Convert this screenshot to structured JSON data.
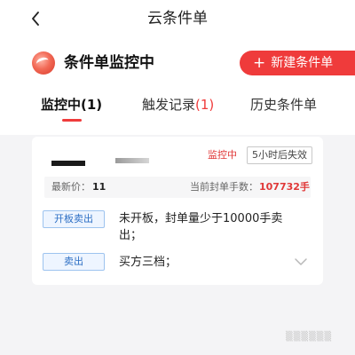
{
  "nav": {
    "title": "云条件单"
  },
  "header": {
    "section_title": "条件单监控中",
    "new_button": "新建条件单"
  },
  "tabs": [
    {
      "label": "监控中",
      "count": "(1)"
    },
    {
      "label": "触发记录",
      "count": "(1)"
    },
    {
      "label": "历史条件单",
      "count": ""
    }
  ],
  "card": {
    "status": "监控中",
    "expire": "5小时后失效",
    "latest_price_label": "最新价：",
    "latest_price": "11",
    "sealed_label": "当前封单手数：",
    "sealed_value": "107732手",
    "conditions": [
      {
        "tag": "开板卖出",
        "line1": "未开板，封单量少于10000手卖",
        "line2": "出；"
      },
      {
        "tag": "卖出",
        "line1": "买方三档；",
        "line2": ""
      }
    ]
  },
  "colors": {
    "accent": "#ef3b3b",
    "tag_blue": "#2d6fc4",
    "background": "#f4f4f6"
  },
  "icons": {
    "back": "chevron-left-icon",
    "logo": "brand-logo-icon",
    "plus": "plus-icon",
    "expand": "chevron-down-icon"
  }
}
